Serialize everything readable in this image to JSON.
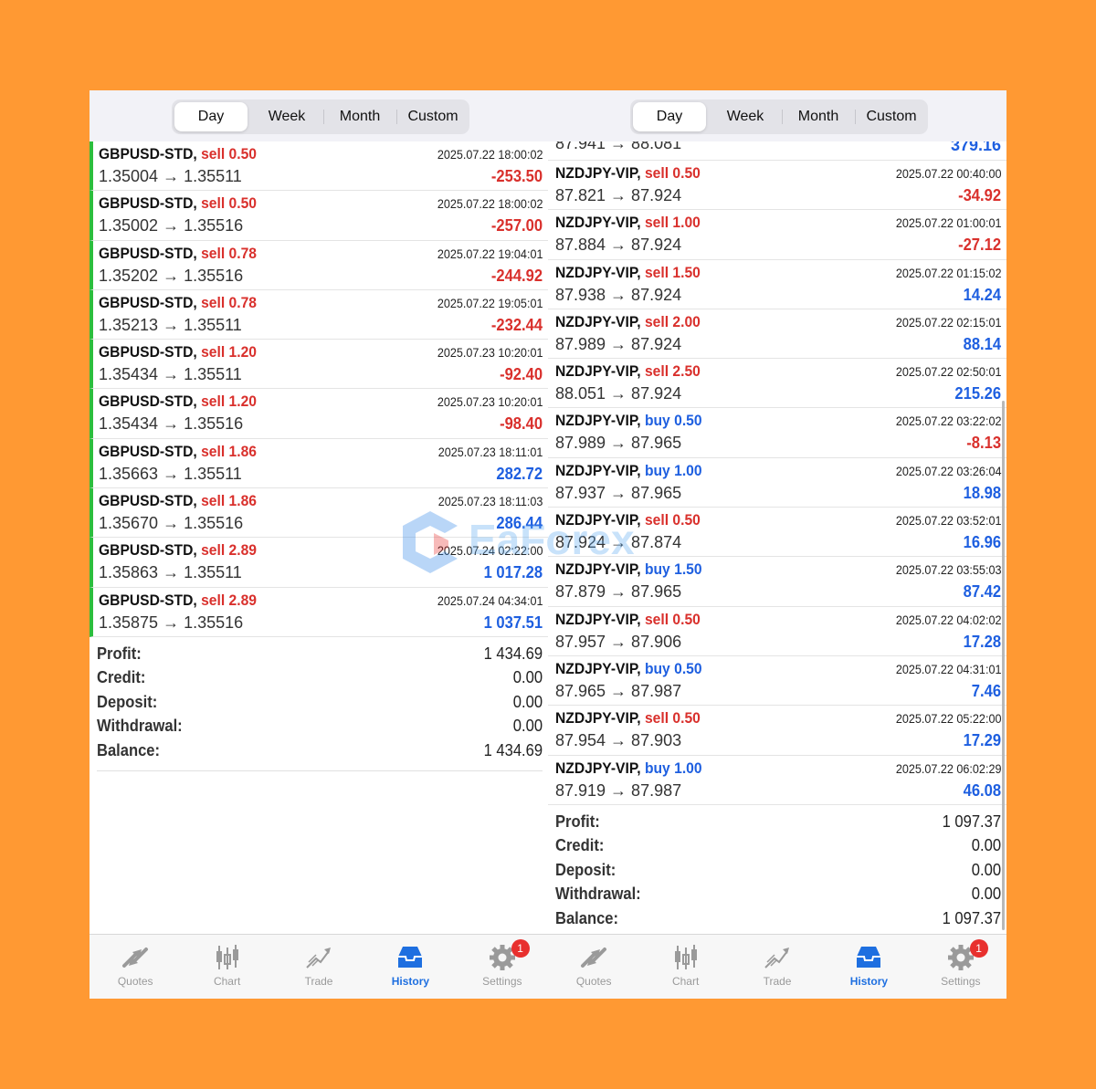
{
  "tabs": [
    "Day",
    "Week",
    "Month",
    "Custom"
  ],
  "selected_tab": "Day",
  "nav": [
    {
      "label": "Quotes",
      "icon": "quotes-icon"
    },
    {
      "label": "Chart",
      "icon": "chart-icon"
    },
    {
      "label": "Trade",
      "icon": "trade-icon"
    },
    {
      "label": "History",
      "icon": "history-icon",
      "active": true
    },
    {
      "label": "Settings",
      "icon": "settings-icon",
      "badge": "1"
    }
  ],
  "watermark": "EaForex",
  "left": {
    "trades": [
      {
        "symbol": "GBPUSD-STD,",
        "side": "sell",
        "volume": "0.50",
        "prices": "1.35004 → 1.35511",
        "time": "2025.07.22 18:00:02",
        "profit": "-253.50"
      },
      {
        "symbol": "GBPUSD-STD,",
        "side": "sell",
        "volume": "0.50",
        "prices": "1.35002 → 1.35516",
        "time": "2025.07.22 18:00:02",
        "profit": "-257.00"
      },
      {
        "symbol": "GBPUSD-STD,",
        "side": "sell",
        "volume": "0.78",
        "prices": "1.35202 → 1.35516",
        "time": "2025.07.22 19:04:01",
        "profit": "-244.92"
      },
      {
        "symbol": "GBPUSD-STD,",
        "side": "sell",
        "volume": "0.78",
        "prices": "1.35213 → 1.35511",
        "time": "2025.07.22 19:05:01",
        "profit": "-232.44"
      },
      {
        "symbol": "GBPUSD-STD,",
        "side": "sell",
        "volume": "1.20",
        "prices": "1.35434 → 1.35511",
        "time": "2025.07.23 10:20:01",
        "profit": "-92.40"
      },
      {
        "symbol": "GBPUSD-STD,",
        "side": "sell",
        "volume": "1.20",
        "prices": "1.35434 → 1.35516",
        "time": "2025.07.23 10:20:01",
        "profit": "-98.40"
      },
      {
        "symbol": "GBPUSD-STD,",
        "side": "sell",
        "volume": "1.86",
        "prices": "1.35663 → 1.35511",
        "time": "2025.07.23 18:11:01",
        "profit": "282.72"
      },
      {
        "symbol": "GBPUSD-STD,",
        "side": "sell",
        "volume": "1.86",
        "prices": "1.35670 → 1.35516",
        "time": "2025.07.23 18:11:03",
        "profit": "286.44"
      },
      {
        "symbol": "GBPUSD-STD,",
        "side": "sell",
        "volume": "2.89",
        "prices": "1.35863 → 1.35511",
        "time": "2025.07.24 02:22:00",
        "profit": "1 017.28"
      },
      {
        "symbol": "GBPUSD-STD,",
        "side": "sell",
        "volume": "2.89",
        "prices": "1.35875 → 1.35516",
        "time": "2025.07.24 04:34:01",
        "profit": "1 037.51"
      }
    ],
    "summary": [
      {
        "label": "Profit:",
        "value": "1 434.69"
      },
      {
        "label": "Credit:",
        "value": "0.00"
      },
      {
        "label": "Deposit:",
        "value": "0.00"
      },
      {
        "label": "Withdrawal:",
        "value": "0.00"
      },
      {
        "label": "Balance:",
        "value": "1 434.69"
      }
    ]
  },
  "right": {
    "partial_top": {
      "prices": "87.941 → 88.081",
      "profit": "379.16"
    },
    "trades": [
      {
        "symbol": "NZDJPY-VIP,",
        "side": "sell",
        "volume": "0.50",
        "prices": "87.821 → 87.924",
        "time": "2025.07.22 00:40:00",
        "profit": "-34.92"
      },
      {
        "symbol": "NZDJPY-VIP,",
        "side": "sell",
        "volume": "1.00",
        "prices": "87.884 → 87.924",
        "time": "2025.07.22 01:00:01",
        "profit": "-27.12"
      },
      {
        "symbol": "NZDJPY-VIP,",
        "side": "sell",
        "volume": "1.50",
        "prices": "87.938 → 87.924",
        "time": "2025.07.22 01:15:02",
        "profit": "14.24"
      },
      {
        "symbol": "NZDJPY-VIP,",
        "side": "sell",
        "volume": "2.00",
        "prices": "87.989 → 87.924",
        "time": "2025.07.22 02:15:01",
        "profit": "88.14"
      },
      {
        "symbol": "NZDJPY-VIP,",
        "side": "sell",
        "volume": "2.50",
        "prices": "88.051 → 87.924",
        "time": "2025.07.22 02:50:01",
        "profit": "215.26"
      },
      {
        "symbol": "NZDJPY-VIP,",
        "side": "buy",
        "volume": "0.50",
        "prices": "87.989 → 87.965",
        "time": "2025.07.22 03:22:02",
        "profit": "-8.13"
      },
      {
        "symbol": "NZDJPY-VIP,",
        "side": "buy",
        "volume": "1.00",
        "prices": "87.937 → 87.965",
        "time": "2025.07.22 03:26:04",
        "profit": "18.98"
      },
      {
        "symbol": "NZDJPY-VIP,",
        "side": "sell",
        "volume": "0.50",
        "prices": "87.924 → 87.874",
        "time": "2025.07.22 03:52:01",
        "profit": "16.96"
      },
      {
        "symbol": "NZDJPY-VIP,",
        "side": "buy",
        "volume": "1.50",
        "prices": "87.879 → 87.965",
        "time": "2025.07.22 03:55:03",
        "profit": "87.42"
      },
      {
        "symbol": "NZDJPY-VIP,",
        "side": "sell",
        "volume": "0.50",
        "prices": "87.957 → 87.906",
        "time": "2025.07.22 04:02:02",
        "profit": "17.28"
      },
      {
        "symbol": "NZDJPY-VIP,",
        "side": "buy",
        "volume": "0.50",
        "prices": "87.965 → 87.987",
        "time": "2025.07.22 04:31:01",
        "profit": "7.46"
      },
      {
        "symbol": "NZDJPY-VIP,",
        "side": "sell",
        "volume": "0.50",
        "prices": "87.954 → 87.903",
        "time": "2025.07.22 05:22:00",
        "profit": "17.29"
      },
      {
        "symbol": "NZDJPY-VIP,",
        "side": "buy",
        "volume": "1.00",
        "prices": "87.919 → 87.987",
        "time": "2025.07.22 06:02:29",
        "profit": "46.08"
      }
    ],
    "summary": [
      {
        "label": "Profit:",
        "value": "1 097.37"
      },
      {
        "label": "Credit:",
        "value": "0.00"
      },
      {
        "label": "Deposit:",
        "value": "0.00"
      },
      {
        "label": "Withdrawal:",
        "value": "0.00"
      },
      {
        "label": "Balance:",
        "value": "1 097.37"
      }
    ]
  }
}
